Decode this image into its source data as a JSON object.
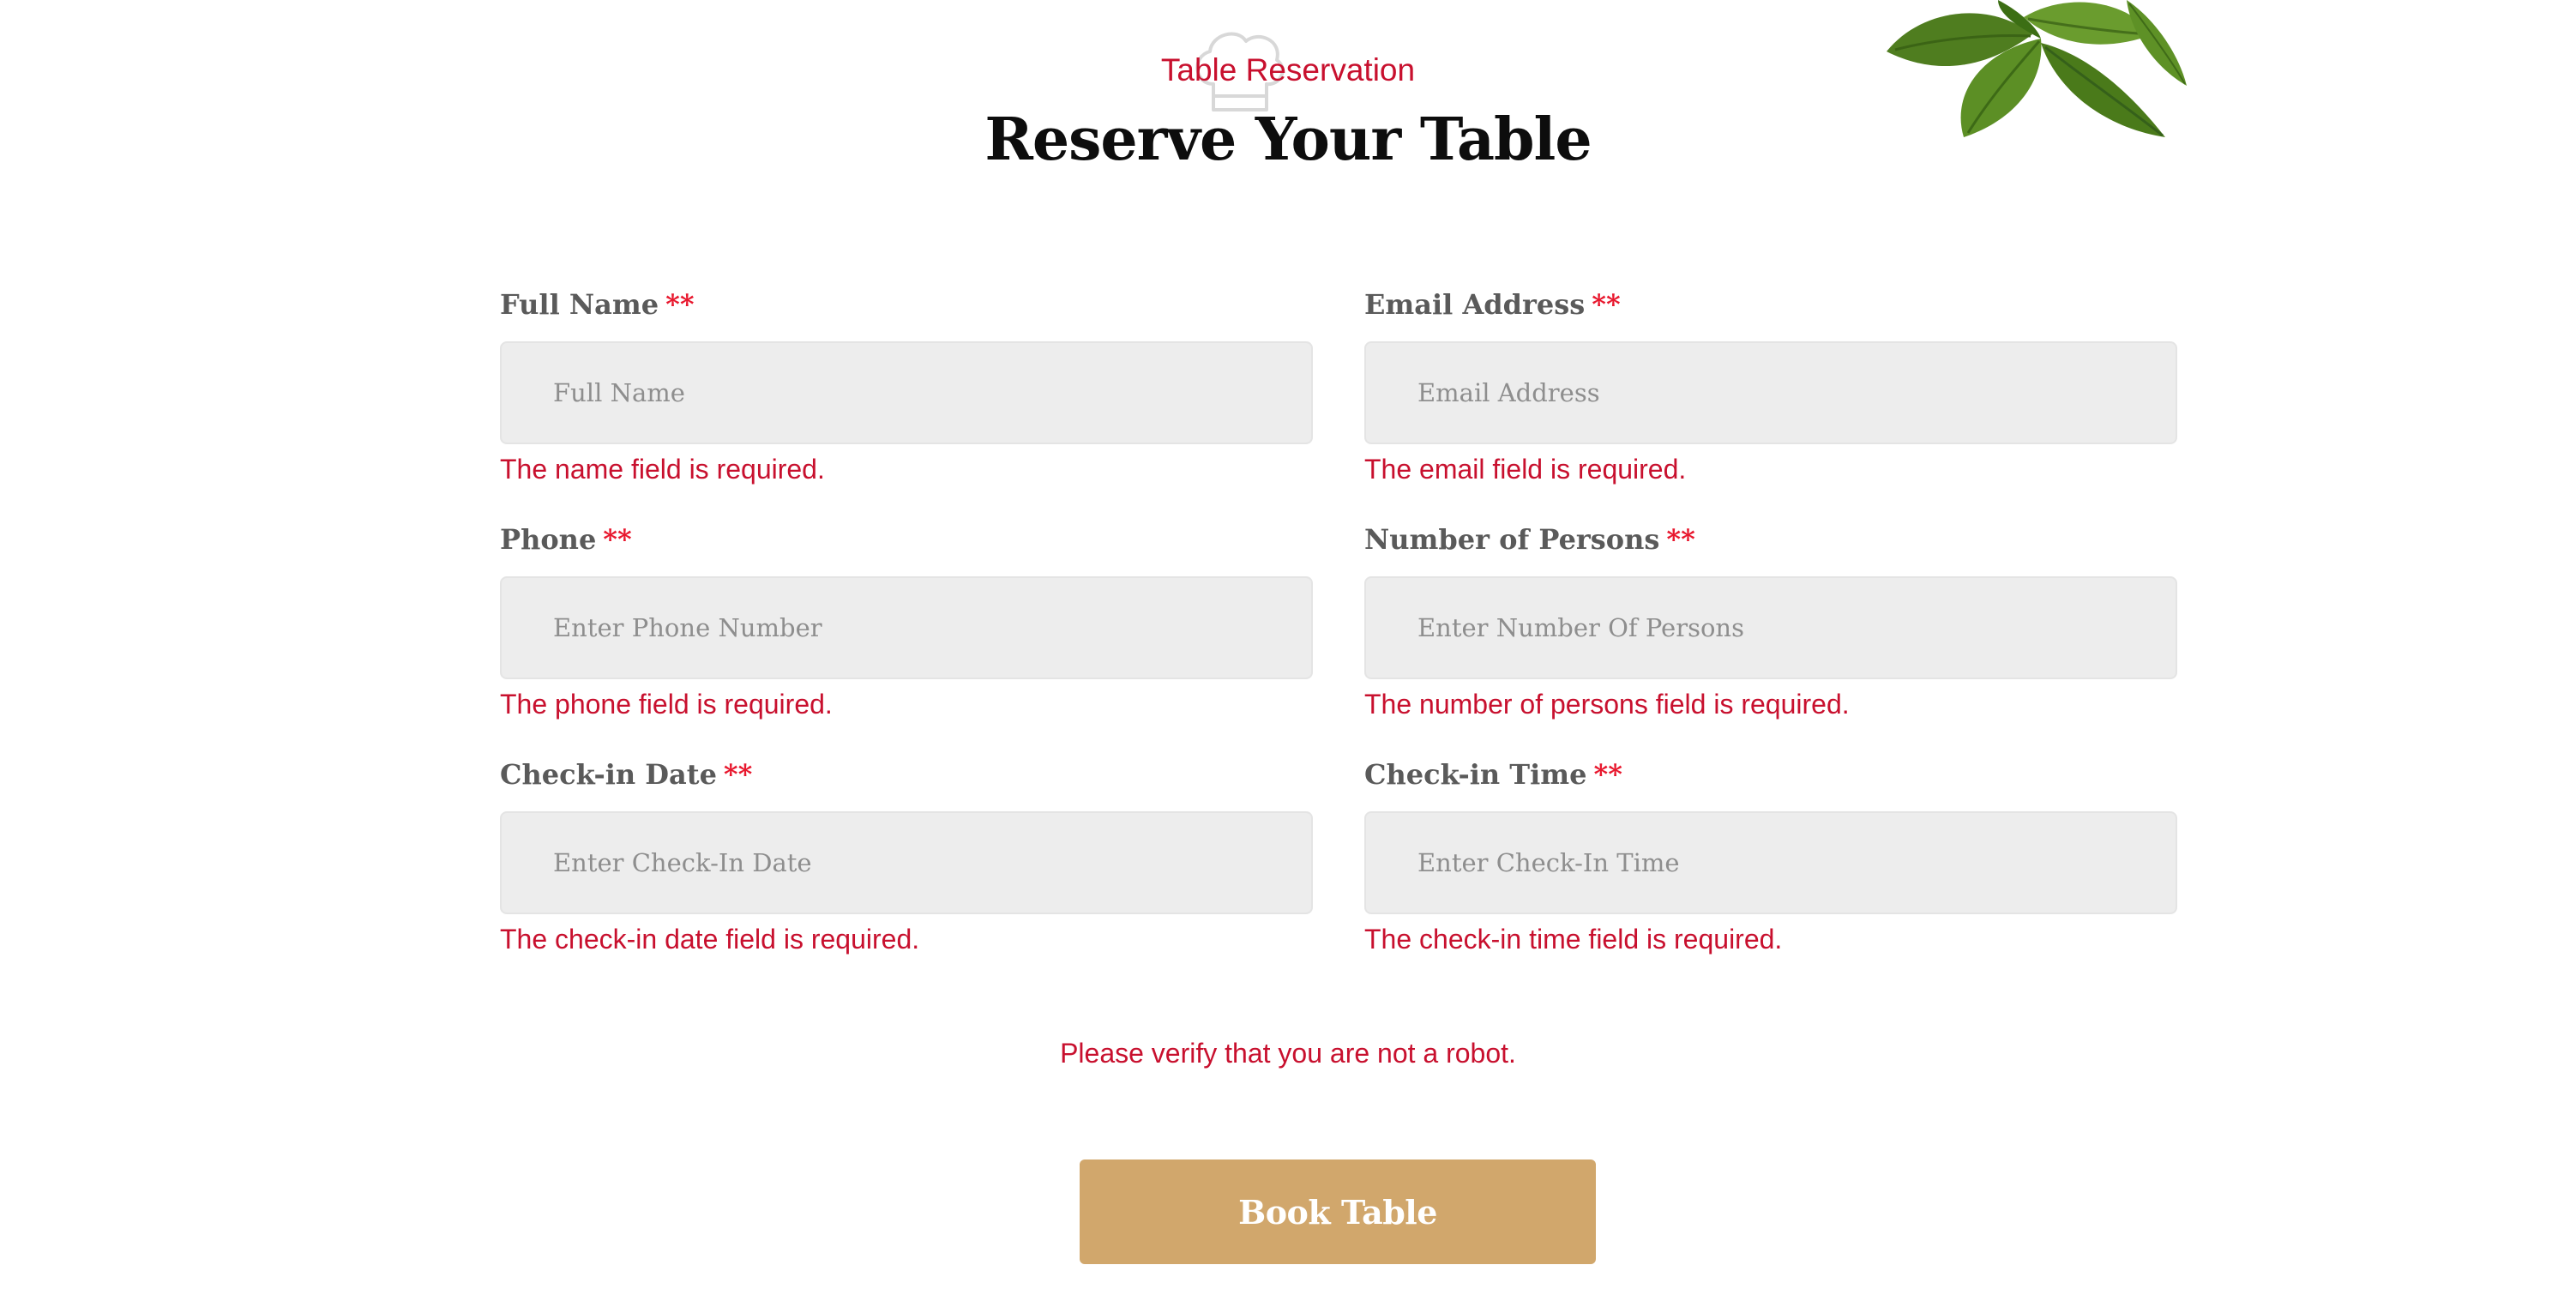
{
  "header": {
    "subtitle": "Table Reservation",
    "title": "Reserve Your Table"
  },
  "form": {
    "required_marker": "**",
    "fields": [
      {
        "label": "Full Name",
        "placeholder": "Full Name",
        "value": "",
        "error": "The name field is required."
      },
      {
        "label": "Email Address",
        "placeholder": "Email Address",
        "value": "",
        "error": "The email field is required."
      },
      {
        "label": "Phone",
        "placeholder": "Enter Phone Number",
        "value": "",
        "error": "The phone field is required."
      },
      {
        "label": "Number of Persons",
        "placeholder": "Enter Number Of Persons",
        "value": "",
        "error": "The number of persons field is required."
      },
      {
        "label": "Check-in Date",
        "placeholder": "Enter Check-In Date",
        "value": "",
        "error": "The check-in date field is required."
      },
      {
        "label": "Check-in Time",
        "placeholder": "Enter Check-In Time",
        "value": "",
        "error": "The check-in time field is required."
      }
    ],
    "captcha_error": "Please verify that you are not a robot.",
    "submit_label": "Book Table"
  },
  "colors": {
    "accent_red": "#c8102e",
    "button_gold": "#d1a76c",
    "input_bg": "#ededed",
    "label_gray": "#5a5a5a"
  },
  "icons": {
    "header_decoration": "chef-hat-icon",
    "corner_decoration": "basil-leaves-icon"
  }
}
